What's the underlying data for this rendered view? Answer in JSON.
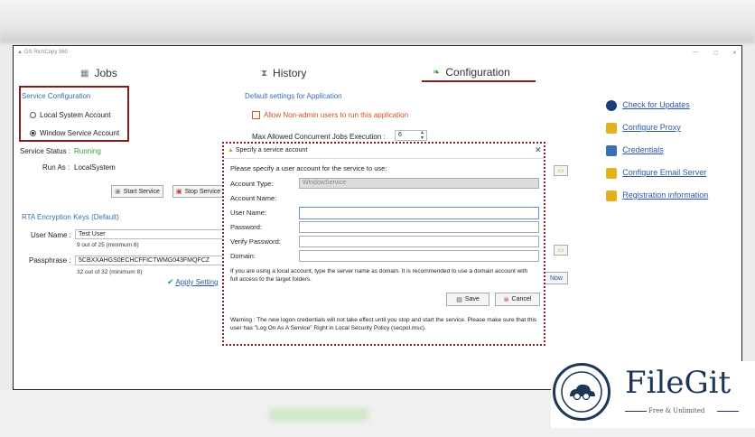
{
  "app": {
    "title": "GS RichCopy 360"
  },
  "tabs": [
    {
      "label": "Jobs",
      "icon": "jobs-icon"
    },
    {
      "label": "History",
      "icon": "history-icon"
    },
    {
      "label": "Configuration",
      "icon": "configuration-icon",
      "active": true
    }
  ],
  "service_config": {
    "title": "Service Configuration",
    "local_system": "Local System Account",
    "window_service": "Window Service Account",
    "selected": "window_service",
    "status_label": "Service Status :",
    "status_value": "Running",
    "status_color": "#3a9a3a",
    "run_as_label": "Run As :",
    "run_as_value": "LocalSystem",
    "start_label": "Start Service",
    "stop_label": "Stop Service"
  },
  "encryption": {
    "title": "RTA Encryption Keys (Default)",
    "username_label": "User Name :",
    "username_value": "Test User",
    "username_hint": "9 out of 25 (minimum 8)",
    "passphrase_label": "Passphrase :",
    "passphrase_value": "5CBXXAHGS0ECHCFFICTWMG043FMQFCZ",
    "passphrase_hint": "32 out of 32 (minimum 8)",
    "apply_label": "Apply Setting"
  },
  "defaults": {
    "title": "Default settings for Application",
    "allow_nonadmin": "Allow Non-admin users to run this application",
    "max_jobs_label": "Max Allowed Concurrent Jobs Execution :",
    "max_jobs_value": "6",
    "now_label": "Now"
  },
  "links": [
    {
      "label": "Check for Updates",
      "icon": "update-icon"
    },
    {
      "label": "Configure Proxy",
      "icon": "shield-icon"
    },
    {
      "label": "Credentials",
      "icon": "users-icon"
    },
    {
      "label": "Configure Email Server",
      "icon": "email-icon"
    },
    {
      "label": "Registration information",
      "icon": "registration-icon"
    }
  ],
  "dialog": {
    "title": "Specify a service account",
    "prompt": "Please specify a user account for the service to use:",
    "account_type_label": "Account Type:",
    "account_type_value": "WindowService",
    "account_name_label": "Account Name:",
    "username_label": "User Name:",
    "password_label": "Password:",
    "verify_label": "Verify Password:",
    "domain_label": "Domain:",
    "info": "If you are using a local account, type the server name as domain. It is recommended to use a domain account with full access to the target folders.",
    "save_label": "Save",
    "cancel_label": "Cancel",
    "warning": "Warning : The new logon credentials will not take effect until you stop and start the service. Please make sure that this user has \"Log On As A Service\" Right in Local Security Policy (secpol.msc)."
  },
  "watermark": {
    "name": "FileGit",
    "tagline": "Free & Unlimited"
  }
}
